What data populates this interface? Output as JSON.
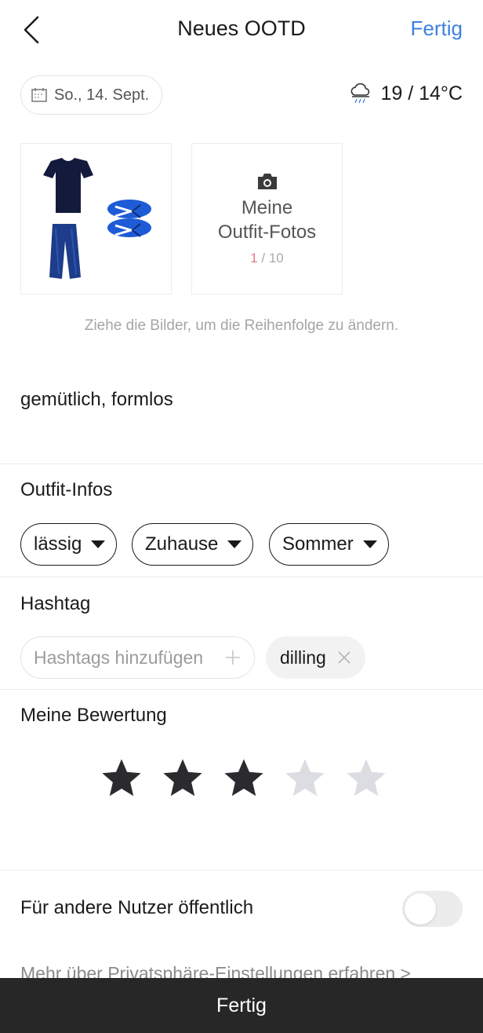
{
  "header": {
    "title": "Neues OOTD",
    "done_label": "Fertig"
  },
  "date": "So., 14. Sept.",
  "weather": {
    "temperature": "19 / 14°C",
    "icon": "cloud-rain-icon"
  },
  "photos": {
    "add_label_line1": "Meine",
    "add_label_line2": "Outfit-Fotos",
    "count_current": "1",
    "count_total": " / 10",
    "hint": "Ziehe die Bilder, um die Reihenfolge zu ändern."
  },
  "description": "gemütlich, formlos",
  "outfit_info": {
    "title": "Outfit-Infos",
    "chips": [
      "lässig",
      "Zuhause",
      "Sommer"
    ]
  },
  "hashtag": {
    "title": "Hashtag",
    "placeholder": "Hashtags hinzufügen",
    "tags": [
      "dilling"
    ]
  },
  "rating": {
    "title": "Meine Bewertung",
    "value": 3,
    "max": 5,
    "filled_color": "#2b2b2f",
    "empty_color": "#dcdde3"
  },
  "privacy": {
    "public_label": "Für andere Nutzer öffentlich",
    "public_enabled": false,
    "more_link": "Mehr über Privatsphäre-Einstellungen erfahren >"
  },
  "footer": {
    "done_label": "Fertig"
  },
  "colors": {
    "accent": "#3f7fe0",
    "bottom_bar": "#272727"
  }
}
